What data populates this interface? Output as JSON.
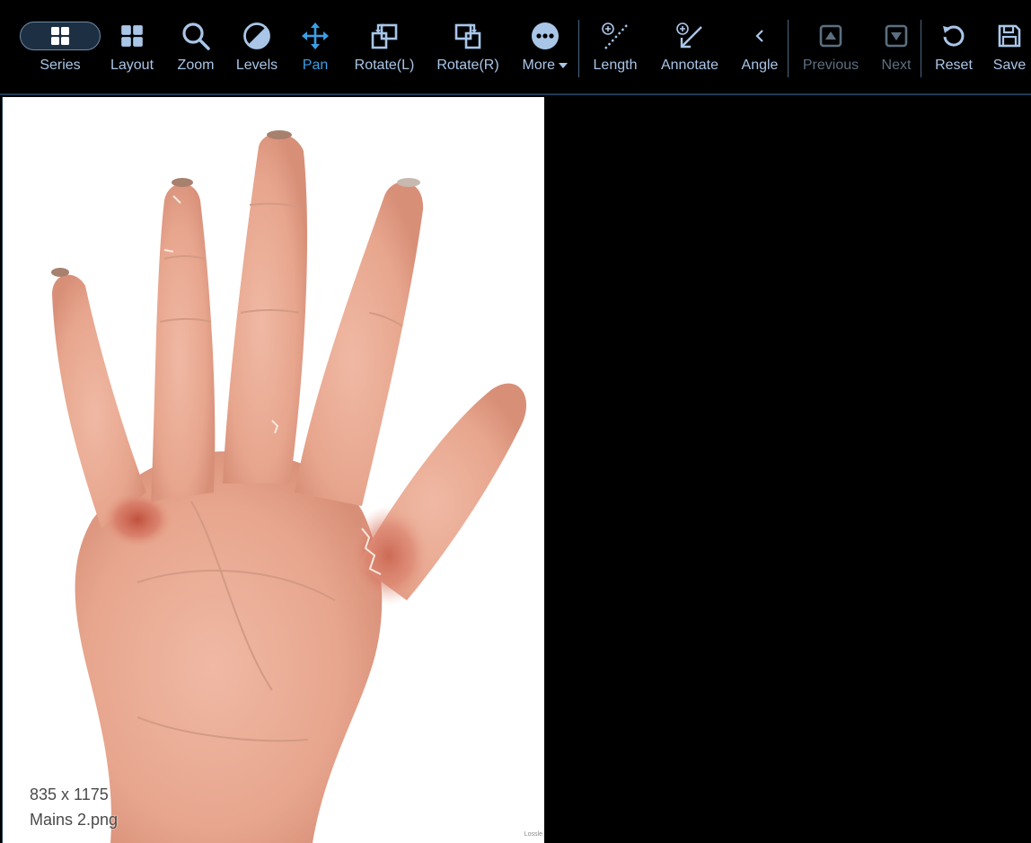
{
  "toolbar": {
    "series": "Series",
    "layout": "Layout",
    "zoom": "Zoom",
    "levels": "Levels",
    "pan": "Pan",
    "rotate_left": "Rotate(L)",
    "rotate_right": "Rotate(R)",
    "more": "More",
    "length": "Length",
    "annotate": "Annotate",
    "angle": "Angle",
    "previous": "Previous",
    "next": "Next",
    "reset": "Reset",
    "save": "Save"
  },
  "colors": {
    "toolbar_icon": "#a9c6e8",
    "active_tool": "#3aa0e6",
    "disabled_tool": "#5c6f80"
  },
  "viewer": {
    "dimensions": "835 x 1175",
    "filename": "Mains 2.png",
    "watermark": "Lossle"
  }
}
